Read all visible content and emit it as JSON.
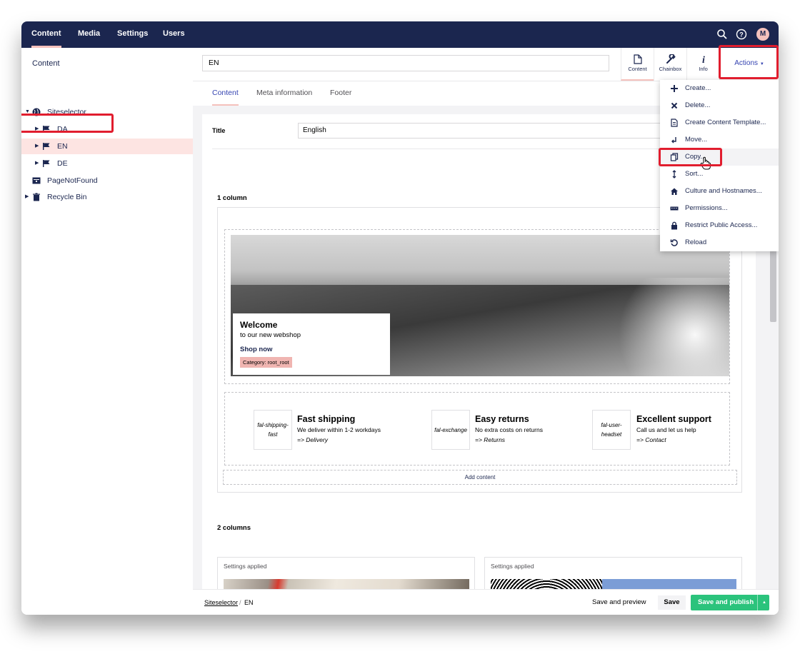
{
  "topnav": {
    "items": [
      {
        "label": "Content",
        "active": true
      },
      {
        "label": "Media"
      },
      {
        "label": "Settings"
      },
      {
        "label": "Users"
      }
    ],
    "avatar_initial": "M",
    "icons": [
      "search-icon",
      "help-icon"
    ]
  },
  "sidebar": {
    "title": "Content",
    "tree": [
      {
        "label": "Siteselector",
        "icon": "globe-icon",
        "expanded": true
      },
      {
        "label": "DA",
        "icon": "flag-icon"
      },
      {
        "label": "EN",
        "icon": "flag-icon",
        "selected": true
      },
      {
        "label": "DE",
        "icon": "flag-icon"
      },
      {
        "label": "PageNotFound",
        "icon": "page-icon"
      },
      {
        "label": "Recycle Bin",
        "icon": "trash-icon"
      }
    ]
  },
  "header": {
    "node_name": "EN",
    "apps": [
      {
        "label": "Content",
        "icon": "document-icon",
        "active": true
      },
      {
        "label": "Chainbox",
        "icon": "wrench-icon"
      },
      {
        "label": "Info",
        "icon": "info-icon"
      }
    ],
    "actions_label": "Actions"
  },
  "subtabs": [
    {
      "label": "Content",
      "active": true
    },
    {
      "label": "Meta information"
    },
    {
      "label": "Footer"
    }
  ],
  "editor": {
    "title_label": "Title",
    "title_value": "English",
    "block1_label": "1 column",
    "hero": {
      "title": "Welcome",
      "subtitle": "to our new webshop",
      "link": "Shop now",
      "badge": "Category: root_root"
    },
    "features": [
      {
        "icon_text": "fal-shipping-fast",
        "title": "Fast shipping",
        "subtitle": "We deliver within 1-2 workdays",
        "link": "=> Delivery"
      },
      {
        "icon_text": "fal-exchange",
        "title": "Easy returns",
        "subtitle": "No extra costs on returns",
        "link": "=> Returns"
      },
      {
        "icon_text": "fal-user-headset",
        "title": "Excellent support",
        "subtitle": "Call us and let us help",
        "link": "=> Contact"
      }
    ],
    "add_content": "Add content",
    "block2_label": "2 columns",
    "col_labels": [
      "Settings applied",
      "Settings applied"
    ]
  },
  "footer": {
    "breadcrumb_root": "Siteselector",
    "breadcrumb_sep": "/",
    "breadcrumb_current": "EN",
    "preview": "Save and preview",
    "save": "Save",
    "publish": "Save and publish"
  },
  "actions_menu": [
    {
      "label": "Create...",
      "icon": "plus-icon"
    },
    {
      "label": "Delete...",
      "icon": "x-icon"
    },
    {
      "label": "Create Content Template...",
      "icon": "template-icon"
    },
    {
      "label": "Move...",
      "icon": "move-icon"
    },
    {
      "label": "Copy...",
      "icon": "copy-icon",
      "highlighted": true
    },
    {
      "label": "Sort...",
      "icon": "sort-icon"
    },
    {
      "label": "Culture and Hostnames...",
      "icon": "home-icon"
    },
    {
      "label": "Permissions...",
      "icon": "permissions-icon"
    },
    {
      "label": "Restrict Public Access...",
      "icon": "lock-icon"
    },
    {
      "label": "Reload",
      "icon": "reload-icon"
    }
  ],
  "colors": {
    "topbar": "#1b264f",
    "accent_pink": "#f5c1bc",
    "selected_row": "#fde4e2",
    "publish_green": "#2bc37c",
    "highlight_red": "#e11d2e"
  }
}
